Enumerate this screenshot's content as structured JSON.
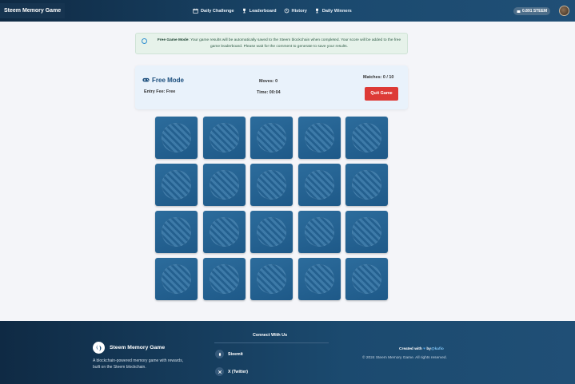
{
  "header": {
    "brand": "Steem Memory Game",
    "nav": [
      {
        "label": "Daily Challenge",
        "icon": "calendar-icon"
      },
      {
        "label": "Leaderboard",
        "icon": "trophy-icon"
      },
      {
        "label": "History",
        "icon": "history-icon"
      },
      {
        "label": "Daily Winners",
        "icon": "trophy-icon"
      }
    ],
    "balance": "0.891 STEEM"
  },
  "banner": {
    "title": "Free Game Mode",
    "text": ": Your game results will be automatically saved to the Steem blockchain when completed. Your score will be added to the free game leaderboard. Please wait for the comment to generate to save your results."
  },
  "panel": {
    "mode": "Free Mode",
    "entry_fee": "Entry Fee: Free",
    "moves": "Moves: 0",
    "time": "Time: 00:04",
    "matches": "Matches: 0 / 10",
    "quit_label": "Quit Game"
  },
  "board": {
    "rows": 4,
    "cols": 5,
    "face_down": true
  },
  "footer": {
    "brand": "Steem Memory Game",
    "description": "A blockchain-powered memory game with rewards, built on the Steem blockchain.",
    "connect_title": "Connect With Us",
    "links": [
      {
        "label": "Steemit",
        "icon": "steemit-icon"
      },
      {
        "label": "X (Twitter)",
        "icon": "x-icon"
      }
    ],
    "created_prefix": "Created with",
    "created_by": "by",
    "created_handle": "@kafio",
    "copyright": "© 2024 Steem Memory Game. All rights reserved."
  },
  "colors": {
    "header_bg": "#163450",
    "card": "#256394",
    "quit_button": "#dd3a36",
    "banner_bg": "#e6f2ea",
    "panel_bg": "#e9f2fb"
  }
}
